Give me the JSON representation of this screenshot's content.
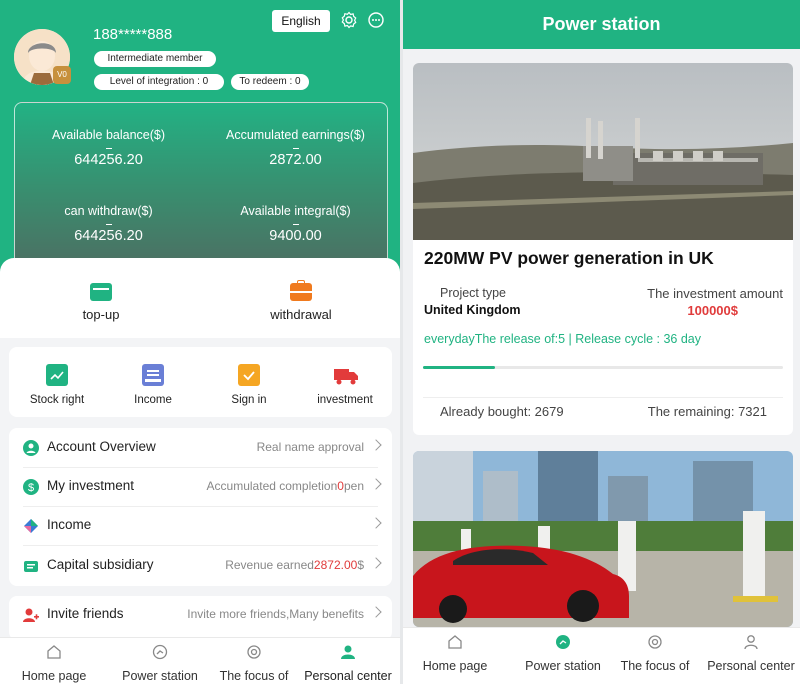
{
  "left": {
    "lang_button": "English",
    "phone": "188*****888",
    "vip_badge": "V0",
    "member_level": "Intermediate member",
    "integration_label": "Level of integration : 0",
    "redeem_label": "To redeem : 0",
    "stats": [
      {
        "label": "Available balance($)",
        "value": "644256.20"
      },
      {
        "label": "Accumulated earnings($)",
        "value": "2872.00"
      },
      {
        "label": "can withdraw($)",
        "value": "644256.20"
      },
      {
        "label": "Available integral($)",
        "value": "9400.00"
      }
    ],
    "topup_label": "top-up",
    "withdrawal_label": "withdrawal",
    "quick": [
      {
        "label": "Stock right",
        "icon": "stock-right-icon",
        "color": "#20b382"
      },
      {
        "label": "Income",
        "icon": "income-icon",
        "color": "#6a7fd6"
      },
      {
        "label": "Sign in",
        "icon": "sign-in-icon",
        "color": "#f5a623"
      },
      {
        "label": "investment",
        "icon": "truck-icon",
        "color": "#e23b3b"
      }
    ],
    "menu": [
      {
        "label": "Account Overview",
        "right": "Real name approval",
        "icon": "user-circle-icon",
        "color": "#20b382"
      },
      {
        "label": "My investment",
        "right_prefix": "Accumulated completion",
        "right_red": "0",
        "right_suffix": "pen",
        "icon": "dollar-icon",
        "color": "#20b382"
      },
      {
        "label": "Income",
        "right": "",
        "icon": "diamond-icon",
        "color": "#3a7bd5"
      },
      {
        "label": "Capital subsidiary",
        "right_prefix": "Revenue earned",
        "right_red": "2872.00",
        "right_suffix": "$",
        "icon": "wallet-icon",
        "color": "#20b382"
      }
    ],
    "invite": {
      "label": "Invite friends",
      "right": "Invite more friends,Many benefits",
      "icon": "invite-icon",
      "color": "#e23b3b"
    },
    "nav": [
      "Home page",
      "Power station",
      "The focus of",
      "Personal center"
    ]
  },
  "right": {
    "header": "Power station",
    "product": {
      "title": "220MW PV power generation in UK",
      "type_label": "Project type",
      "type_value": "United Kingdom",
      "amount_label": "The investment amount",
      "amount_value": "100000$",
      "release_text": "everydayThe release of:5 | Release cycle : 36 day",
      "progress": 0.2,
      "bought_label": "Already bought: 2679",
      "remaining_label": "The remaining: 7321"
    },
    "nav": [
      "Home page",
      "Power station",
      "The focus of",
      "Personal center"
    ]
  },
  "colors": {
    "brand": "#20b382",
    "red": "#e03b3b"
  }
}
